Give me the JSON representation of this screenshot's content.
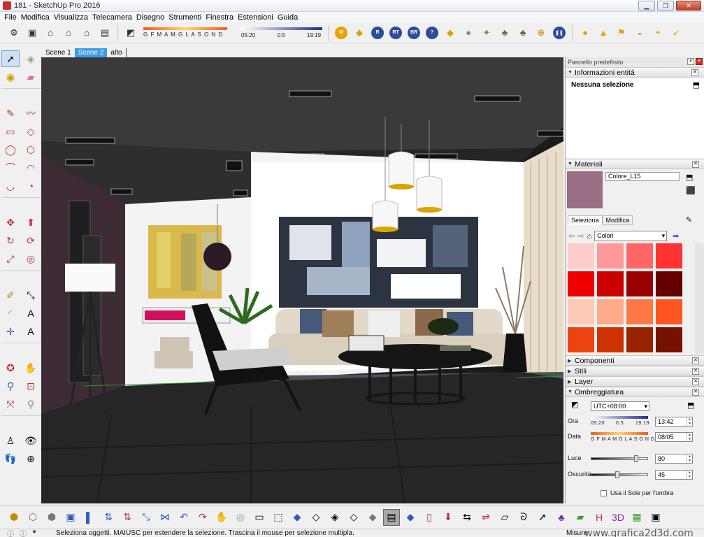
{
  "window": {
    "title": "181 - SketchUp Pro 2016",
    "buttons": {
      "minimize": "▁",
      "maximize": "❐",
      "close": "✕"
    }
  },
  "menu": [
    "File",
    "Modifica",
    "Visualizza",
    "Telecamera",
    "Disegno",
    "Strumenti",
    "Finestra",
    "Estensioni",
    "Guida"
  ],
  "toolbar": {
    "shadow_months": "G F M A M G L A S O N D",
    "time_start": "05:20",
    "time_mid": "0.5",
    "time_end": "19:19",
    "round_buttons": [
      "M",
      "R",
      "RT",
      "BR",
      "?"
    ]
  },
  "scenes": {
    "tabs": [
      "Scene 1",
      "Scene 2",
      "alto"
    ],
    "active": "Scene 2"
  },
  "panel": {
    "title": "Pannello predefinito",
    "entity_info": {
      "header": "Informazioni entità",
      "selection": "Nessuna selezione"
    },
    "materials": {
      "header": "Materiali",
      "current_name": "Colore_L15",
      "tabs": [
        "Seleziona",
        "Modifica"
      ],
      "library": "Colori",
      "current_color": "#9a6e84",
      "swatches": [
        "#ffcccc",
        "#ff9999",
        "#ff6666",
        "#ff3333",
        "#ee0000",
        "#cc0000",
        "#990000",
        "#660000",
        "#ffc9b8",
        "#ffaa88",
        "#ff7744",
        "#ff5522",
        "#ee4411",
        "#cc3300",
        "#992200",
        "#771100"
      ]
    },
    "collapsed_sections": [
      "Componenti",
      "Stili",
      "Layer"
    ],
    "shadows": {
      "header": "Ombreggiatura",
      "timezone": "UTC+08:00",
      "time_label": "Ora",
      "time_start": "05:20",
      "time_mid": "0.5",
      "time_end": "19:19",
      "time_value": "13:42",
      "date_label": "Data",
      "months": "G F M A M G L A S O N D",
      "date_value": "08/05",
      "light_label": "Luce",
      "light_value": "80",
      "dark_label": "Oscurità",
      "dark_value": "45",
      "sun_checkbox": "Usa il Sole per l'ombra"
    }
  },
  "status": {
    "text": "Seleziona oggetti. MAIUSC per estendere la selezione. Trascina il mouse per selezione multipla.",
    "measure_label": "Misure",
    "watermark": "www.grafica2d3d.com"
  }
}
